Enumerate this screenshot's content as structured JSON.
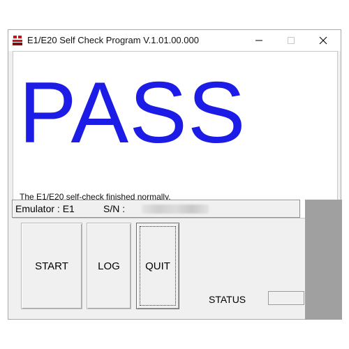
{
  "window": {
    "title": "E1/E20 Self Check Program V.1.01.00.000",
    "icon": "renesas-app-icon",
    "controls": [
      "minimize-icon",
      "maximize-icon",
      "close-icon"
    ]
  },
  "result": {
    "headline": "PASS",
    "headline_color": "#1c1ce6",
    "message": "The E1/E20 self-check finished normally."
  },
  "info": {
    "emulator_label": "Emulator : E1",
    "sn_label": "S/N :"
  },
  "buttons": {
    "start": "START",
    "log": "LOG",
    "quit": "QUIT"
  },
  "status": {
    "label": "STATUS",
    "value": ""
  }
}
